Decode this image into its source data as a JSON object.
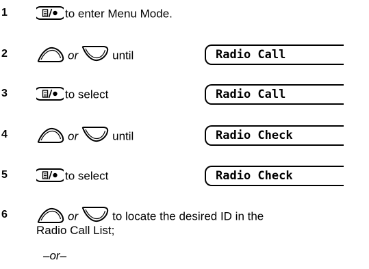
{
  "steps": [
    {
      "num": "1",
      "text": "to enter Menu Mode.",
      "buttons": [
        "menu"
      ]
    },
    {
      "num": "2",
      "or": "or",
      "text": "until",
      "display": "Radio Call",
      "buttons": [
        "up",
        "down"
      ]
    },
    {
      "num": "3",
      "text": "to select",
      "display": "Radio Call",
      "buttons": [
        "menu"
      ]
    },
    {
      "num": "4",
      "or": "or",
      "text": "until",
      "display": "Radio Check",
      "buttons": [
        "up",
        "down"
      ]
    },
    {
      "num": "5",
      "text": "to select",
      "display": "Radio Check",
      "buttons": [
        "menu"
      ]
    },
    {
      "num": "6",
      "or": "or",
      "text": "to locate the desired ID in the",
      "text_cont": "Radio Call List;",
      "buttons": [
        "up",
        "down"
      ]
    }
  ],
  "alt": "–or–",
  "icons": {
    "menu": "menu-select-button-icon",
    "up": "up-arrow-button-icon",
    "down": "down-arrow-button-icon"
  }
}
